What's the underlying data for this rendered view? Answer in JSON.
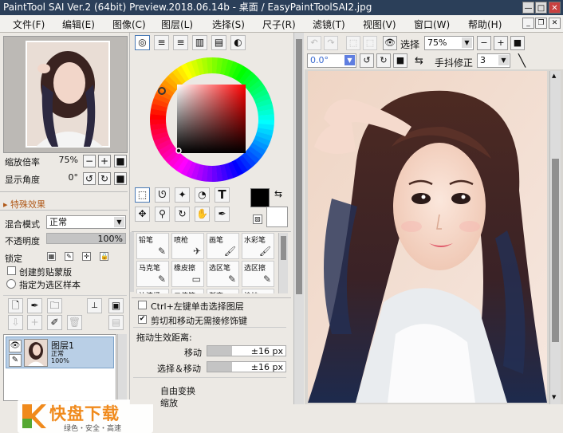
{
  "window": {
    "title": "PaintTool SAI Ver.2 (64bit) Preview.2018.06.14b - 桌面 / EasyPaintToolSAI2.jpg"
  },
  "menu": [
    "文件(F)",
    "编辑(E)",
    "图像(C)",
    "图层(L)",
    "选择(S)",
    "尺子(R)",
    "滤镜(T)",
    "视图(V)",
    "窗口(W)",
    "帮助(H)"
  ],
  "navigator": {
    "zoom_label": "缩放倍率",
    "zoom_value": "75%",
    "angle_label": "显示角度",
    "angle_value": "0°"
  },
  "effects": {
    "header": "特殊效果"
  },
  "layer_props": {
    "blend_label": "混合模式",
    "blend_value": "正常",
    "opacity_label": "不透明度",
    "opacity_value": "100%",
    "opacity": 1.0,
    "lock_label": "锁定",
    "clipping_label": "创建剪贴蒙版",
    "selection_source_label": "指定为选区样本"
  },
  "layer": {
    "name": "图层1",
    "mode": "正常",
    "opacity": "100%"
  },
  "watermark": {
    "brand": "快盘下载",
    "tagline": "绿色・安全・高速"
  },
  "color": {
    "primary": "#000000",
    "secondary": "#ffffff"
  },
  "brushes": [
    {
      "name": "铅笔",
      "icon": "✎"
    },
    {
      "name": "喷枪",
      "icon": "✈"
    },
    {
      "name": "画笔",
      "icon": "🖌"
    },
    {
      "name": "水彩笔",
      "icon": "🖌"
    },
    {
      "name": "马克笔",
      "icon": "✎"
    },
    {
      "name": "橡皮擦",
      "icon": "▭"
    },
    {
      "name": "选区笔",
      "icon": "✎"
    },
    {
      "name": "选区擦",
      "icon": "✎"
    },
    {
      "name": "油漆桶",
      "icon": "▣"
    },
    {
      "name": "二值笔",
      "icon": "✎"
    },
    {
      "name": "渐变",
      "icon": "▥"
    },
    {
      "name": "涂抹",
      "icon": "✋"
    }
  ],
  "tool_options": {
    "ctrl_click_label": "Ctrl+左键单击选择图层",
    "cut_move_label": "剪切和移动无需接修饰键",
    "drag_distance_label": "拖动生效距离:",
    "move_label": "移动",
    "move_value": "±16 px",
    "select_move_label": "选择＆移动",
    "select_move_value": "±16 px",
    "free_transform_label": "自由变换",
    "scale_label": "缩放"
  },
  "canvas_toolbar": {
    "select_label": "选择",
    "zoom_value": "75%",
    "rotation_value": "0.0°",
    "stabilizer_label": "手抖修正",
    "stabilizer_value": "3"
  }
}
